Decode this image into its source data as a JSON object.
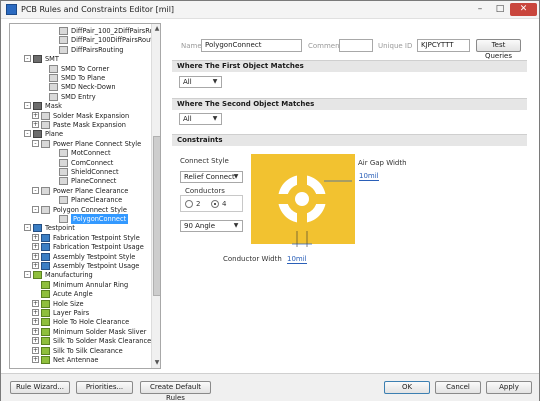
{
  "window": {
    "title": "PCB Rules and Constraints Editor [mil]",
    "minimize": "–",
    "maximize": "□",
    "close": "✕"
  },
  "tree": [
    {
      "label": "DiffPair_100_2DiffPairsRout",
      "icon": "rule",
      "indent": 4
    },
    {
      "label": "DiffPair_100DiffPairsRoutin",
      "icon": "rule",
      "indent": 4
    },
    {
      "label": "DiffPairsRouting",
      "icon": "rule",
      "indent": 4
    },
    {
      "label": "SMT",
      "icon": "cat",
      "indent": 1,
      "exp": "-"
    },
    {
      "label": "SMD To Corner",
      "icon": "rule",
      "indent": 3
    },
    {
      "label": "SMD To Plane",
      "icon": "rule",
      "indent": 3
    },
    {
      "label": "SMD Neck-Down",
      "icon": "rule",
      "indent": 3
    },
    {
      "label": "SMD Entry",
      "icon": "rule",
      "indent": 3
    },
    {
      "label": "Mask",
      "icon": "cat",
      "indent": 1,
      "exp": "-"
    },
    {
      "label": "Solder Mask Expansion",
      "icon": "rule",
      "indent": 2,
      "exp": "+"
    },
    {
      "label": "Paste Mask Expansion",
      "icon": "rule",
      "indent": 2,
      "exp": "+"
    },
    {
      "label": "Plane",
      "icon": "cat",
      "indent": 1,
      "exp": "-"
    },
    {
      "label": "Power Plane Connect Style",
      "icon": "rule",
      "indent": 2,
      "exp": "-"
    },
    {
      "label": "MotConnect",
      "icon": "rule",
      "indent": 4
    },
    {
      "label": "ComConnect",
      "icon": "rule",
      "indent": 4
    },
    {
      "label": "ShieldConnect",
      "icon": "rule",
      "indent": 4
    },
    {
      "label": "PlaneConnect",
      "icon": "rule",
      "indent": 4
    },
    {
      "label": "Power Plane Clearance",
      "icon": "rule",
      "indent": 2,
      "exp": "-"
    },
    {
      "label": "PlaneClearance",
      "icon": "rule",
      "indent": 4
    },
    {
      "label": "Polygon Connect Style",
      "icon": "rule",
      "indent": 2,
      "exp": "-"
    },
    {
      "label": "PolygonConnect",
      "icon": "rule",
      "indent": 4,
      "selected": true
    },
    {
      "label": "Testpoint",
      "icon": "test",
      "indent": 1,
      "exp": "-"
    },
    {
      "label": "Fabrication Testpoint Style",
      "icon": "test",
      "indent": 2,
      "exp": "+"
    },
    {
      "label": "Fabrication Testpoint Usage",
      "icon": "test",
      "indent": 2,
      "exp": "+"
    },
    {
      "label": "Assembly Testpoint Style",
      "icon": "test",
      "indent": 2,
      "exp": "+"
    },
    {
      "label": "Assembly Testpoint Usage",
      "icon": "test",
      "indent": 2,
      "exp": "+"
    },
    {
      "label": "Manufacturing",
      "icon": "mfg",
      "indent": 1,
      "exp": "-"
    },
    {
      "label": "Minimum Annular Ring",
      "icon": "mfg",
      "indent": 2
    },
    {
      "label": "Acute Angle",
      "icon": "mfg",
      "indent": 2
    },
    {
      "label": "Hole Size",
      "icon": "mfg",
      "indent": 2,
      "exp": "+"
    },
    {
      "label": "Layer Pairs",
      "icon": "mfg",
      "indent": 2,
      "exp": "+"
    },
    {
      "label": "Hole To Hole Clearance",
      "icon": "mfg",
      "indent": 2,
      "exp": "+"
    },
    {
      "label": "Minimum Solder Mask Sliver",
      "icon": "mfg",
      "indent": 2,
      "exp": "+"
    },
    {
      "label": "Silk To Solder Mask Clearance",
      "icon": "mfg",
      "indent": 2,
      "exp": "+"
    },
    {
      "label": "Silk To Silk Clearance",
      "icon": "mfg",
      "indent": 2,
      "exp": "+"
    },
    {
      "label": "Net Antennae",
      "icon": "mfg",
      "indent": 2,
      "exp": "+"
    }
  ],
  "rule": {
    "name_label": "Name",
    "name_value": "PolygonConnect",
    "comment_label": "Comment",
    "comment_value": "",
    "uid_label": "Unique ID",
    "uid_value": "KJPCYTTT",
    "test_queries": "Test Queries"
  },
  "first_match": {
    "heading": "Where The First Object Matches",
    "value": "All"
  },
  "second_match": {
    "heading": "Where The Second Object Matches",
    "value": "All"
  },
  "constraints": {
    "heading": "Constraints",
    "connect_style_label": "Connect Style",
    "connect_style_value": "Relief Connect",
    "conductors_label": "Conductors",
    "conductor_options": [
      "2",
      "4"
    ],
    "conductor_selected": "4",
    "angle_value": "90 Angle",
    "air_gap_label": "Air Gap Width",
    "air_gap_value": "10mil",
    "conductor_width_label": "Conductor Width",
    "conductor_width_value": "10mil",
    "copper_color": "#f2c230"
  },
  "footer": {
    "rule_wizard": "Rule Wizard...",
    "priorities": "Priorities...",
    "create_default": "Create Default Rules",
    "ok": "OK",
    "cancel": "Cancel",
    "apply": "Apply"
  }
}
